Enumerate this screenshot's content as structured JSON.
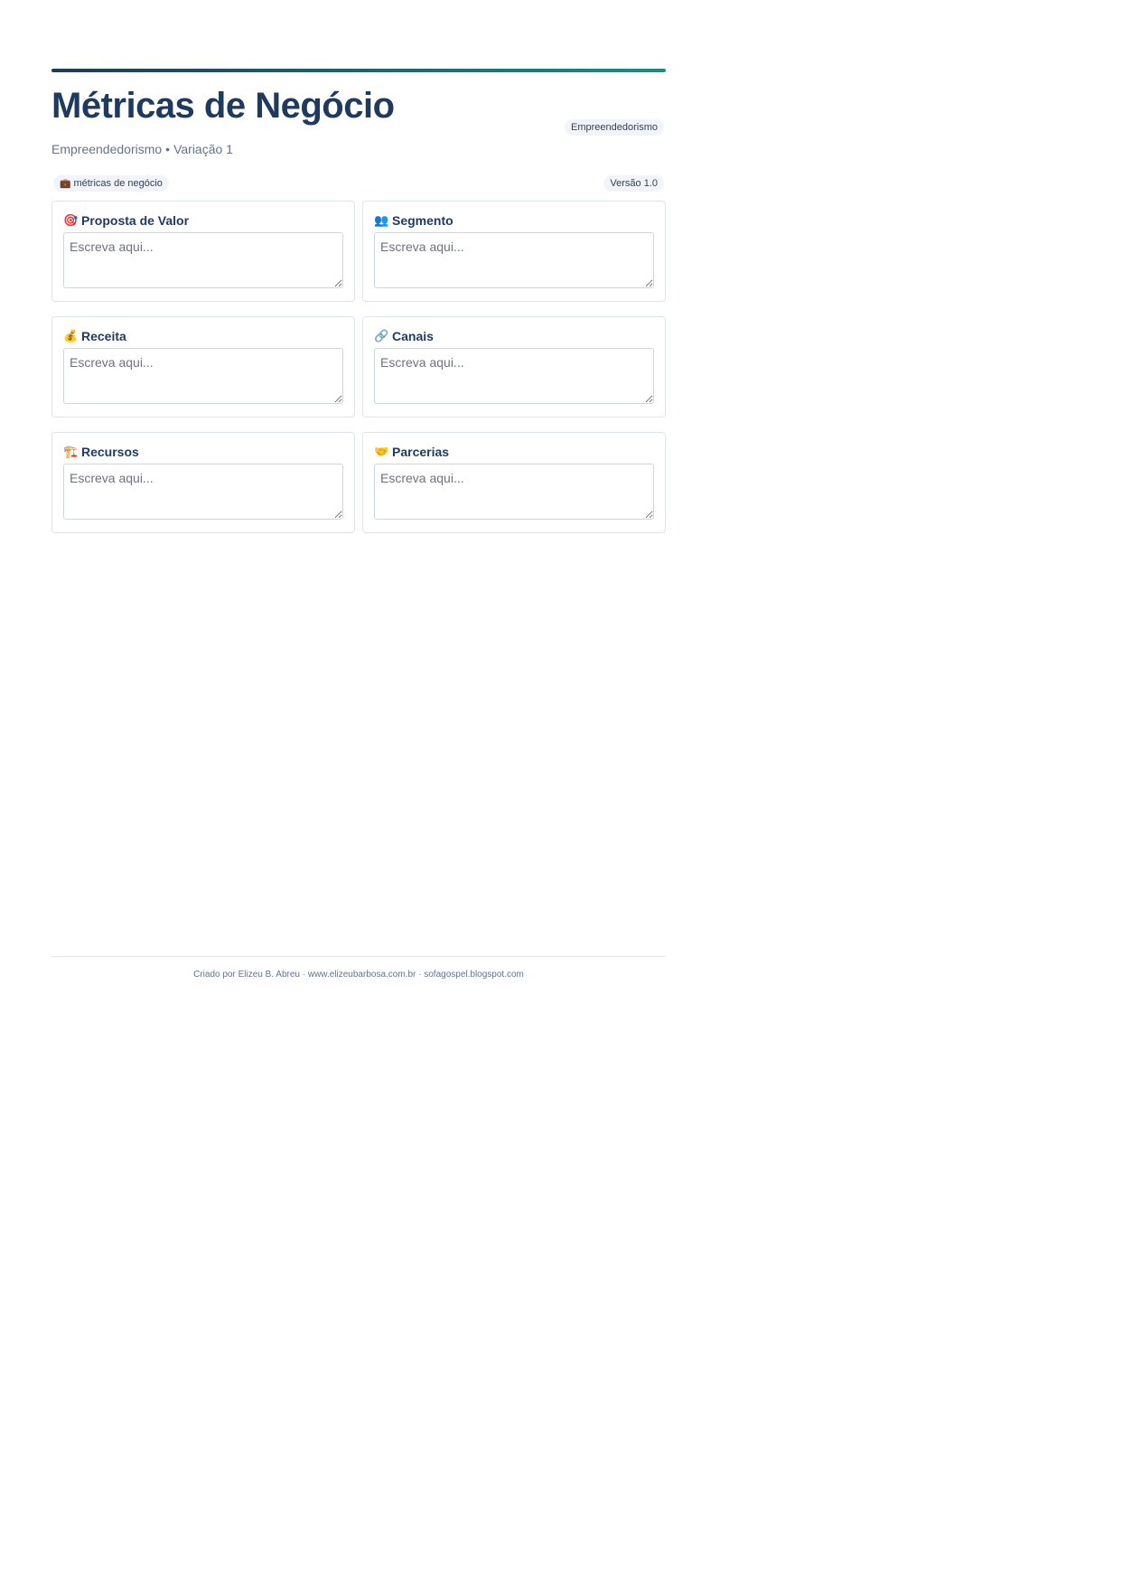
{
  "header": {
    "title": "Métricas de Negócio",
    "subtitle_category": "Empreendedorismo",
    "subtitle_separator": "•",
    "subtitle_variation": "Variação 1",
    "category_badge": "Empreendedorismo"
  },
  "meta": {
    "tag_icon": "briefcase-icon",
    "tag_icon_glyph": "💼",
    "tag_label": "métricas de negócio",
    "version": "Versão 1.0"
  },
  "cards": [
    {
      "icon": "target-icon",
      "glyph": "🎯",
      "title": "Proposta de Valor",
      "placeholder": "Escreva aqui..."
    },
    {
      "icon": "people-icon",
      "glyph": "👥",
      "title": "Segmento",
      "placeholder": "Escreva aqui..."
    },
    {
      "icon": "money-bag-icon",
      "glyph": "💰",
      "title": "Receita",
      "placeholder": "Escreva aqui..."
    },
    {
      "icon": "link-icon",
      "glyph": "🔗",
      "title": "Canais",
      "placeholder": "Escreva aqui..."
    },
    {
      "icon": "construction-icon",
      "glyph": "🏗️",
      "title": "Recursos",
      "placeholder": "Escreva aqui..."
    },
    {
      "icon": "handshake-icon",
      "glyph": "🤝",
      "title": "Parcerias",
      "placeholder": "Escreva aqui..."
    }
  ],
  "footer": {
    "text": "Criado por Elizeu B. Abreu · www.elizeubarbosa.com.br · sofagospel.blogspot.com"
  },
  "colors": {
    "primary": "#1e3a5f",
    "accent": "#17907e",
    "muted": "#64748b"
  }
}
